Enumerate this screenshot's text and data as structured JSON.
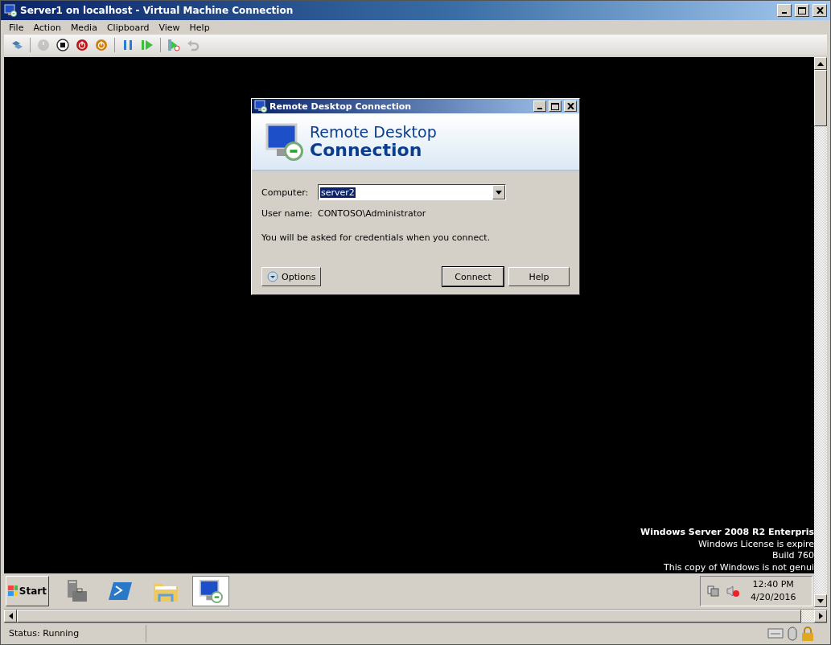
{
  "window": {
    "title": "Server1 on localhost - Virtual Machine Connection"
  },
  "menu": [
    "File",
    "Action",
    "Media",
    "Clipboard",
    "View",
    "Help"
  ],
  "toolbar": [
    [
      {
        "kind": "keys",
        "disabled": false
      }
    ],
    [
      {
        "kind": "start",
        "disabled": true
      },
      {
        "kind": "turn-off",
        "disabled": false
      },
      {
        "kind": "shut-down",
        "disabled": false
      },
      {
        "kind": "save",
        "disabled": false
      }
    ],
    [
      {
        "kind": "pause",
        "disabled": false
      },
      {
        "kind": "reset",
        "disabled": false
      }
    ],
    [
      {
        "kind": "snapshot",
        "disabled": false
      },
      {
        "kind": "revert",
        "disabled": true
      }
    ]
  ],
  "dialog": {
    "title": "Remote Desktop Connection",
    "banner": [
      "Remote Desktop",
      "Connection"
    ],
    "computer_label": "Computer:",
    "computer_value": "server2",
    "value_selected": true,
    "user_label": "User name:",
    "user_value": "CONTOSO\\Administrator",
    "note": "You will be asked for credentials when you connect.",
    "buttons": [
      {
        "kind": "options",
        "label": "Options",
        "default": false
      },
      {
        "kind": "plain",
        "label": "Connect",
        "default": true
      },
      {
        "kind": "plain",
        "label": "Help",
        "default": false
      }
    ]
  },
  "desktop_text": [
    {
      "text": "Windows Server 2008 R2 Enterpris",
      "bold": true
    },
    {
      "text": "Windows License is expire",
      "bold": false
    },
    {
      "text": "Build 760",
      "bold": false
    },
    {
      "text": "This copy of Windows is not genui",
      "bold": false
    }
  ],
  "taskbar": {
    "start": "Start",
    "apps": [
      {
        "kind": "server-manager",
        "active": false
      },
      {
        "kind": "powershell",
        "active": false
      },
      {
        "kind": "explorer",
        "active": false
      },
      {
        "kind": "remote-desktop",
        "active": true
      }
    ],
    "clock": {
      "time": "12:40 PM",
      "date": "4/20/2016"
    }
  },
  "status_bar": {
    "text": "Status: Running"
  }
}
